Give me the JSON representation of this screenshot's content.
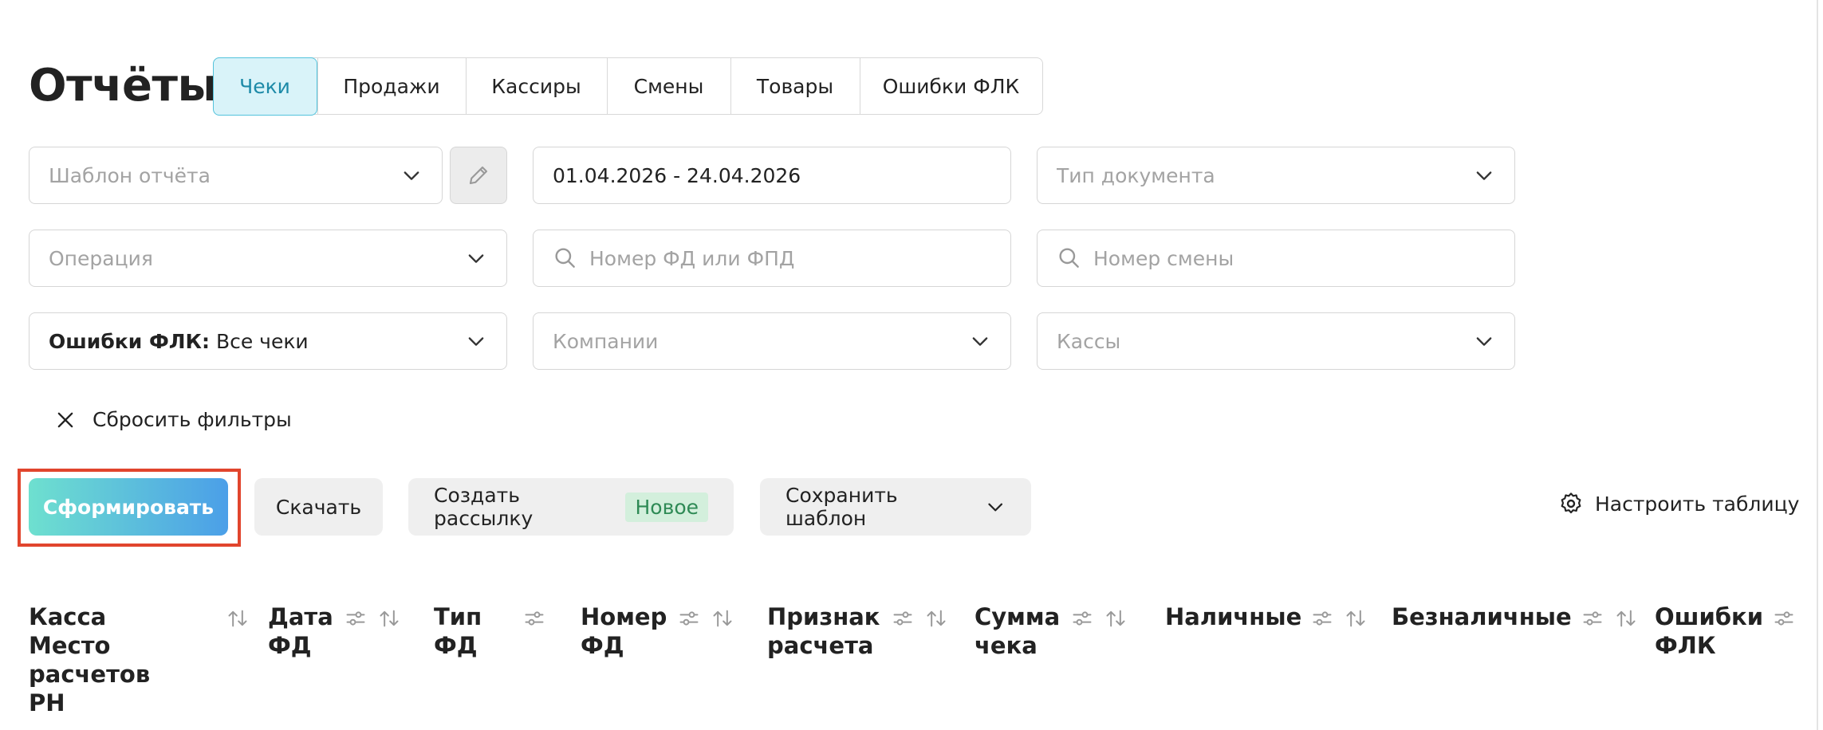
{
  "page": {
    "title": "Отчёты"
  },
  "tabs": [
    {
      "label": "Чеки",
      "active": true
    },
    {
      "label": "Продажи",
      "active": false
    },
    {
      "label": "Кассиры",
      "active": false
    },
    {
      "label": "Смены",
      "active": false
    },
    {
      "label": "Товары",
      "active": false
    },
    {
      "label": "Ошибки ФЛК",
      "active": false
    }
  ],
  "filters": {
    "template": {
      "placeholder": "Шаблон отчёта"
    },
    "date_range": {
      "value": "01.04.2026 - 24.04.2026"
    },
    "doc_type": {
      "placeholder": "Тип документа"
    },
    "operation": {
      "placeholder": "Операция"
    },
    "fd_number": {
      "placeholder": "Номер ФД или ФПД"
    },
    "shift_number": {
      "placeholder": "Номер смены"
    },
    "flk_errors": {
      "label": "Ошибки ФЛК:",
      "value": "Все чеки"
    },
    "companies": {
      "placeholder": "Компании"
    },
    "registers": {
      "placeholder": "Кассы"
    }
  },
  "actions": {
    "reset_label": "Сбросить фильтры",
    "generate_label": "Сформировать",
    "download_label": "Скачать",
    "mailing_label": "Создать рассылку",
    "mailing_badge": "Новое",
    "save_template_label": "Сохранить шаблон",
    "configure_table_label": "Настроить таблицу"
  },
  "table": {
    "columns": [
      {
        "label": "Касса\nМесто\nрасчетов\nРН",
        "filter": false,
        "sort": true
      },
      {
        "label": "Дата\nФД",
        "filter": true,
        "sort": true
      },
      {
        "label": "Тип\nФД",
        "filter": true,
        "sort": false
      },
      {
        "label": "Номер\nФД",
        "filter": true,
        "sort": true
      },
      {
        "label": "Признак\nрасчета",
        "filter": true,
        "sort": true
      },
      {
        "label": "Сумма\nчека",
        "filter": true,
        "sort": true
      },
      {
        "label": "Наличные",
        "filter": true,
        "sort": true
      },
      {
        "label": "Безналичные",
        "filter": true,
        "sort": true
      },
      {
        "label": "Ошибки\nФЛК",
        "filter": true,
        "sort": false
      }
    ]
  },
  "colors": {
    "accent": "#1d8aa8",
    "tab_active_bg": "#d9f3f9",
    "primary_gradient_start": "#6ee0cf",
    "primary_gradient_end": "#4b9fe8",
    "highlight_border": "#e1452d",
    "badge_bg": "#d3efdc",
    "badge_text": "#2e8a55"
  },
  "icons": [
    "chevron-down-icon",
    "pencil-icon",
    "search-icon",
    "close-icon",
    "gear-icon",
    "filter-sliders-icon",
    "sort-arrows-icon"
  ]
}
